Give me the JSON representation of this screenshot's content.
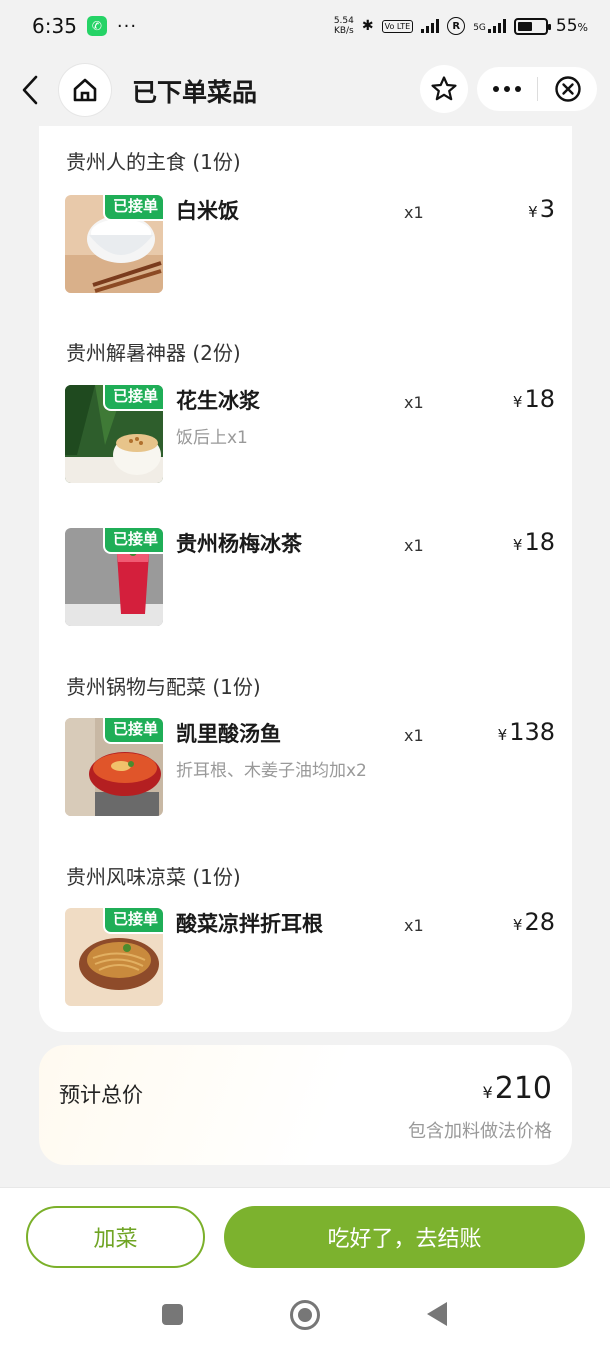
{
  "status_bar": {
    "time": "6:35",
    "speed_value": "5.54",
    "speed_unit": "KB/s",
    "volte": "Vo LTE",
    "network": "5G",
    "battery_pct": "55",
    "battery_unit": "%",
    "battery_level": 0.55
  },
  "nav": {
    "title": "已下单菜品",
    "back_icon": "chevron-left-icon",
    "home_icon": "home-icon",
    "star_icon": "star-icon",
    "more_icon": "more-dots-icon",
    "close_icon": "close-circle-icon"
  },
  "categories": [
    {
      "title": "贵州人的主食 (1份)",
      "items": [
        {
          "badge": "已接单",
          "name": "白米饭",
          "note": "",
          "qty": "x1",
          "currency": "¥",
          "price": "3"
        }
      ]
    },
    {
      "title": "贵州解暑神器 (2份)",
      "items": [
        {
          "badge": "已接单",
          "name": "花生冰浆",
          "note": "饭后上x1",
          "qty": "x1",
          "currency": "¥",
          "price": "18"
        },
        {
          "badge": "已接单",
          "name": "贵州杨梅冰茶",
          "note": "",
          "qty": "x1",
          "currency": "¥",
          "price": "18"
        }
      ]
    },
    {
      "title": "贵州锅物与配菜 (1份)",
      "items": [
        {
          "badge": "已接单",
          "name": "凯里酸汤鱼",
          "note": "折耳根、木姜子油均加x2",
          "qty": "x1",
          "currency": "¥",
          "price": "138"
        }
      ]
    },
    {
      "title": "贵州风味凉菜 (1份)",
      "items": [
        {
          "badge": "已接单",
          "name": "酸菜凉拌折耳根",
          "note": "",
          "qty": "x1",
          "currency": "¥",
          "price": "28"
        }
      ]
    }
  ],
  "total": {
    "label": "预计总价",
    "currency": "¥",
    "value": "210",
    "note": "包含加料做法价格"
  },
  "actions": {
    "add_label": "加菜",
    "checkout_label": "吃好了，去结账"
  },
  "colors": {
    "accent_green": "#7cb22e",
    "badge_green": "#1fae57",
    "background": "#f2f2f2"
  }
}
